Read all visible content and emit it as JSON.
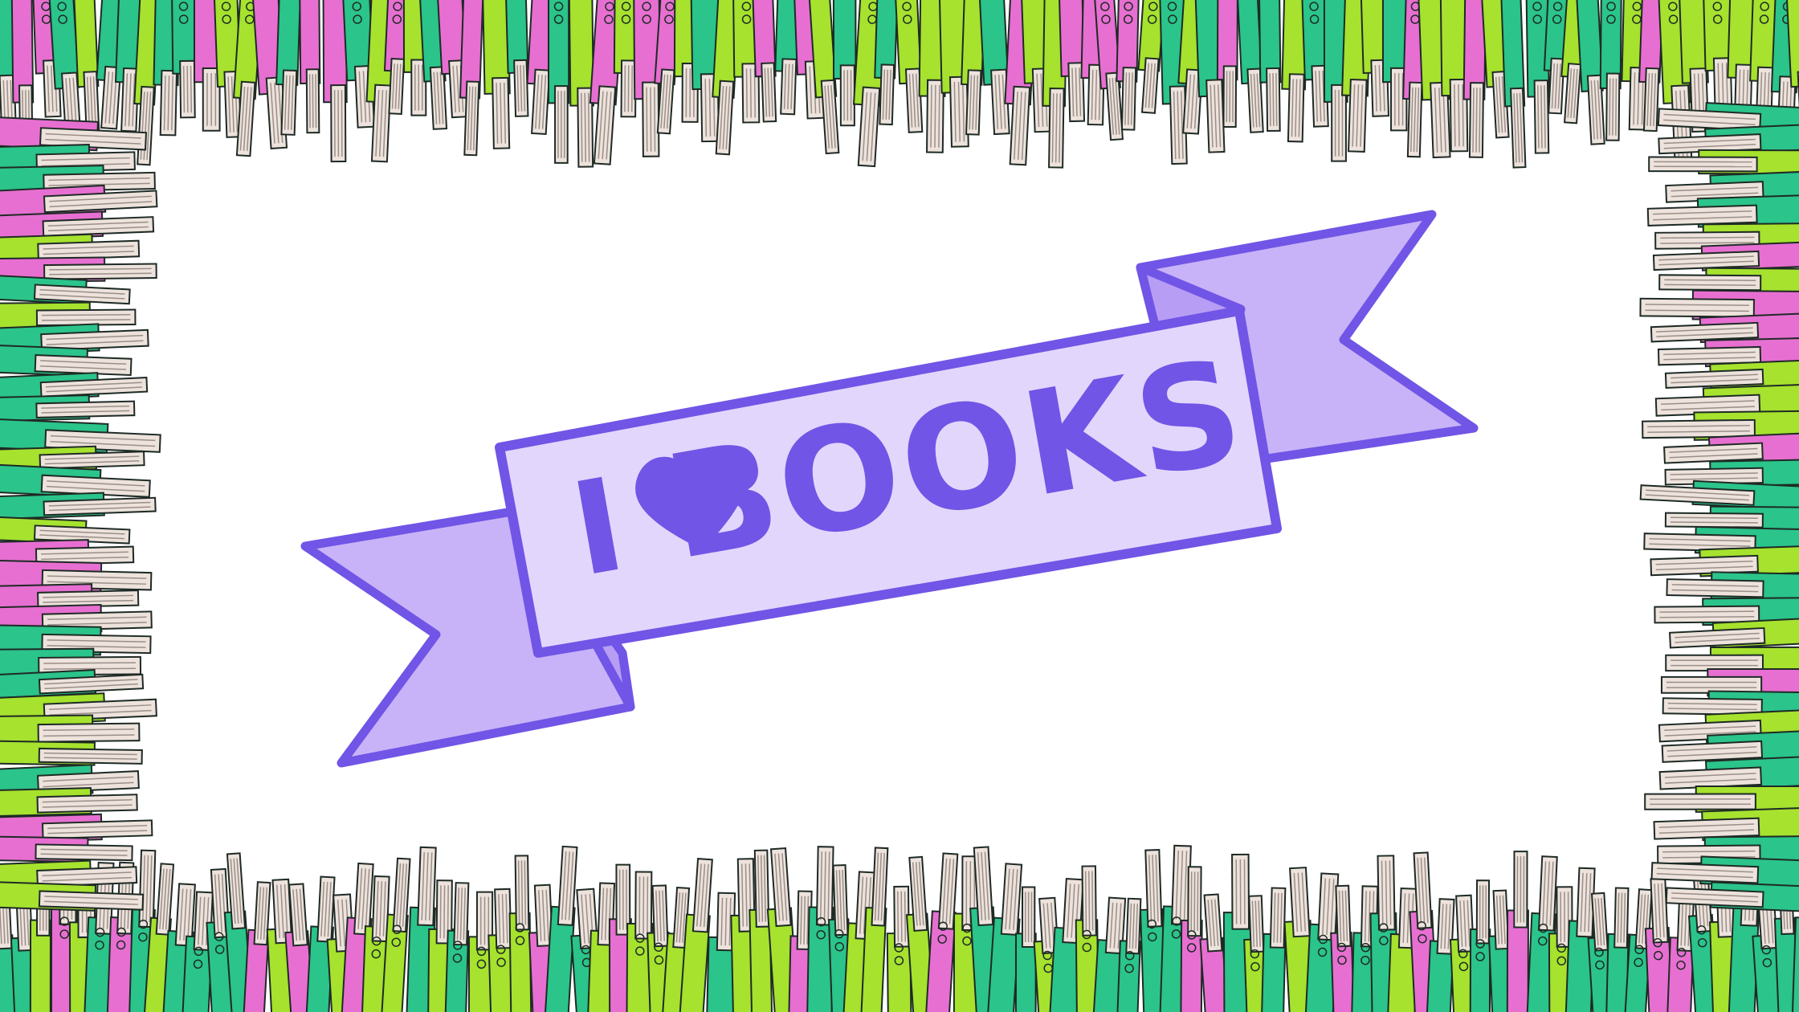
{
  "banner": {
    "left_word": "I",
    "right_word": "BOOKS",
    "icon": "heart-icon"
  },
  "colors": {
    "outline": "#7155E6",
    "ribbon_face": "#E3D6FC",
    "ribbon_tail": "#C8B3F8",
    "book_green": "#2BC48B",
    "book_lime": "#A6E22E",
    "book_pink": "#E76FD1",
    "book_pages": "#EDE3DC",
    "book_ink": "#1E2A25",
    "background": "#FFFFFF"
  }
}
